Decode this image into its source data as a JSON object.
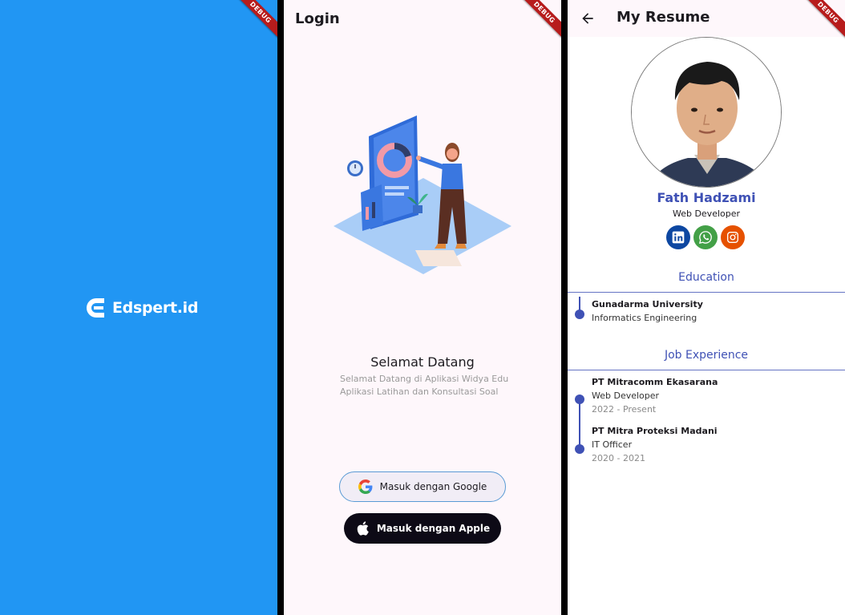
{
  "debug_label": "DEBUG",
  "splash": {
    "brand": "Edspert.id",
    "bg_color": "#2196F3"
  },
  "login": {
    "title": "Login",
    "welcome_title": "Selamat Datang",
    "welcome_line1": "Selamat Datang di Aplikasi Widya Edu",
    "welcome_line2": "Aplikasi Latihan dan Konsultasi Soal",
    "google_button": "Masuk dengan Google",
    "apple_button": "Masuk dengan Apple",
    "icons": [
      "google-icon",
      "apple-icon"
    ]
  },
  "resume": {
    "title": "My Resume",
    "name": "Fath Hadzami",
    "role": "Web Developer",
    "socials": [
      {
        "icon": "linkedin-icon",
        "color": "#0D47A1"
      },
      {
        "icon": "whatsapp-icon",
        "color": "#43A047"
      },
      {
        "icon": "instagram-icon",
        "color": "#E65100"
      }
    ],
    "education_title": "Education",
    "education": [
      {
        "school": "Gunadarma University",
        "major": "Informatics Engineering"
      }
    ],
    "job_title": "Job Experience",
    "jobs": [
      {
        "company": "PT Mitracomm Ekasarana",
        "position": "Web Developer",
        "period": "2022 - Present"
      },
      {
        "company": "PT Mitra Proteksi Madani",
        "position": "IT Officer",
        "period": "2020 - 2021"
      }
    ],
    "accent_color": "#3F51B5"
  }
}
